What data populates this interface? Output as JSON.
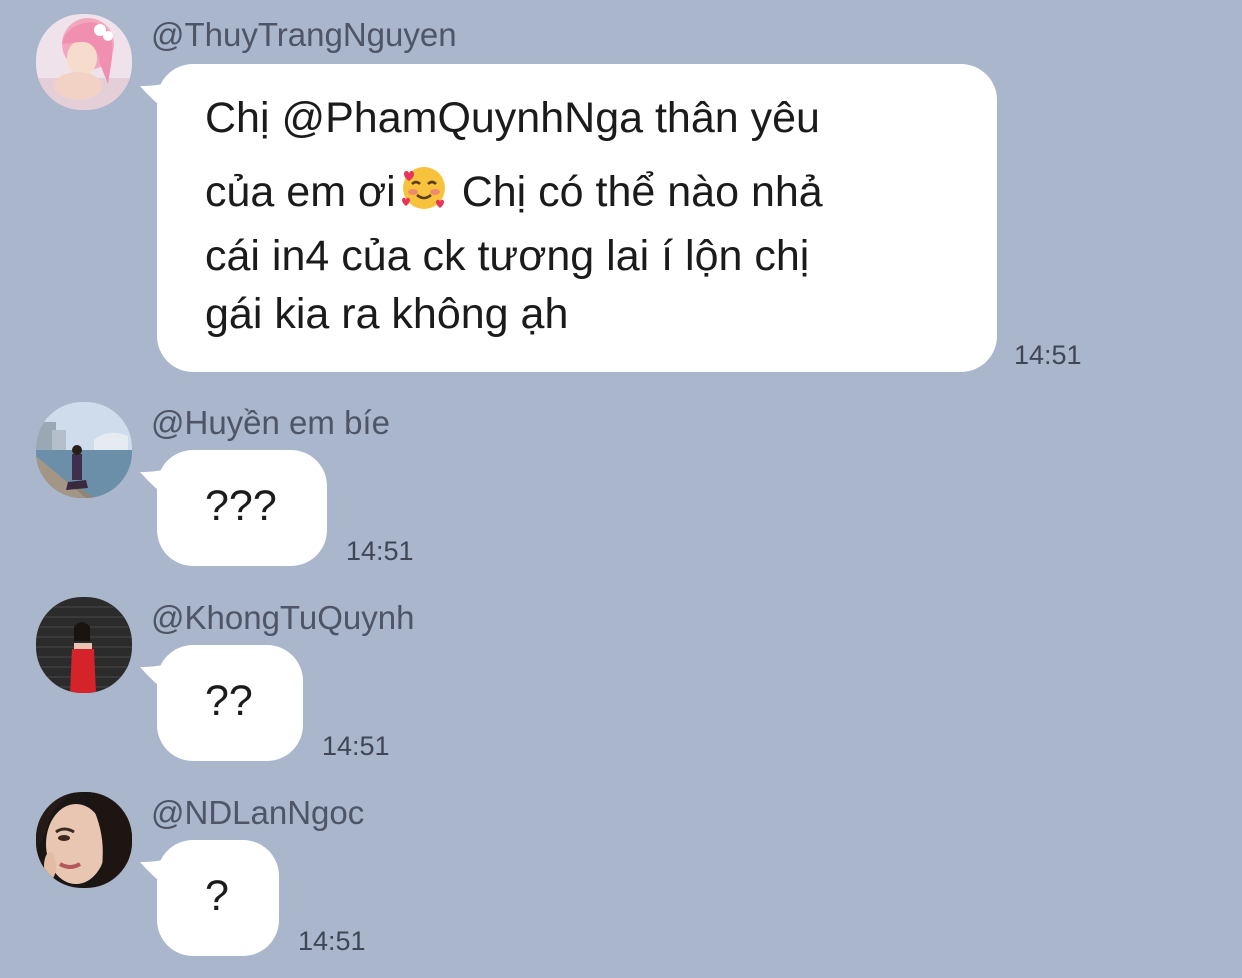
{
  "messages": [
    {
      "sender": "@ThuyTrangNguyen",
      "lines": [
        "Chị @PhamQuynhNga thân yêu",
        "của em ơi",
        "Chị có thể nào nhả",
        "cái in4 của ck tương lai í lộn chị",
        "gái kia ra không ạh"
      ],
      "emoji": "smiling-face-with-hearts",
      "time": "14:51"
    },
    {
      "sender": "@Huyền em bíe",
      "text": "???",
      "time": "14:51"
    },
    {
      "sender": "@KhongTuQuynh",
      "text": "??",
      "time": "14:51"
    },
    {
      "sender": "@NDLanNgoc",
      "text": "?",
      "time": "14:51"
    }
  ],
  "colors": {
    "background": "#aab6cb",
    "bubble": "#ffffff",
    "sender_text": "#4d5566",
    "time_text": "#3f4757"
  }
}
